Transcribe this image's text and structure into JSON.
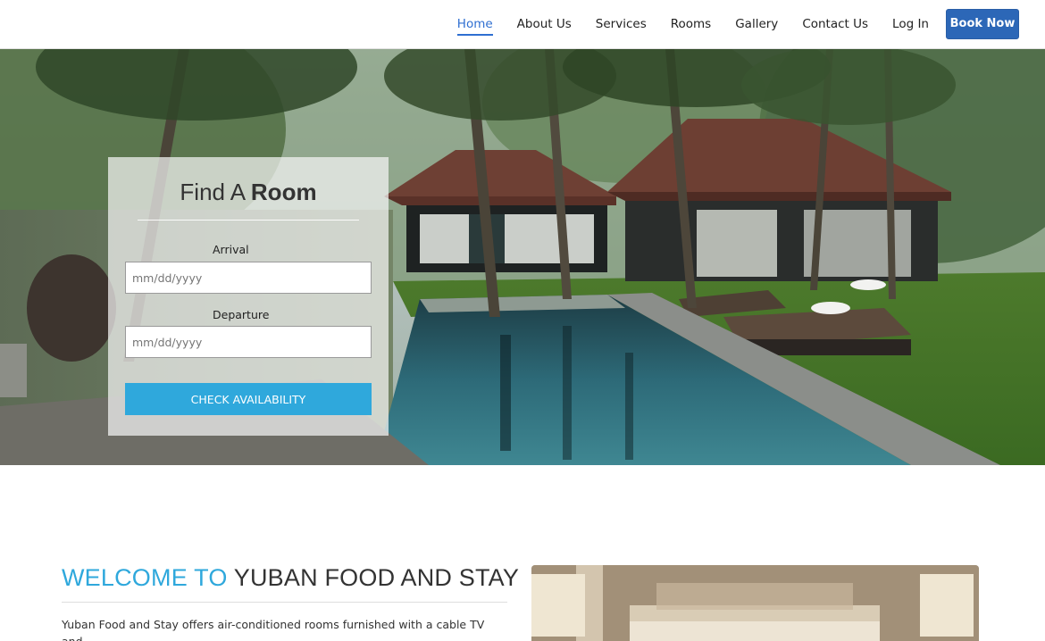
{
  "nav": {
    "items": [
      {
        "label": "Home",
        "active": true
      },
      {
        "label": "About Us",
        "active": false
      },
      {
        "label": "Services",
        "active": false
      },
      {
        "label": "Rooms",
        "active": false
      },
      {
        "label": "Gallery",
        "active": false
      },
      {
        "label": "Contact Us",
        "active": false
      },
      {
        "label": "Log In",
        "active": false
      }
    ],
    "book_label": "Book Now"
  },
  "search": {
    "title_light": "Find A ",
    "title_bold": "Room",
    "arrival_label": "Arrival",
    "arrival_placeholder": "mm/dd/yyyy",
    "departure_label": "Departure",
    "departure_placeholder": "mm/dd/yyyy",
    "button_label": "CHECK AVAILABILITY"
  },
  "welcome": {
    "title_accent": "WELCOME TO",
    "title_rest": "YUBAN FOOD AND STAY",
    "text": "Yuban Food and Stay offers air-conditioned rooms furnished with a cable TV and"
  },
  "colors": {
    "accent": "#2fa8dc",
    "nav_active": "#2f6fd1",
    "book_button": "#2c67b7"
  }
}
